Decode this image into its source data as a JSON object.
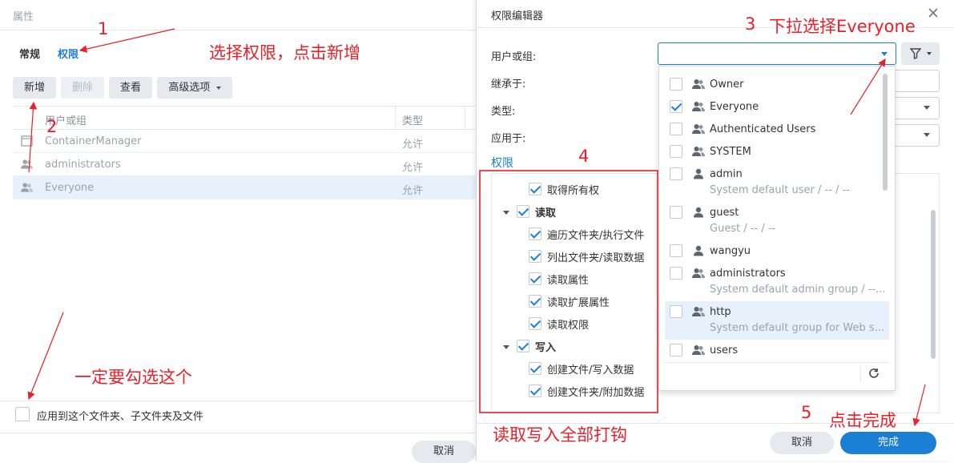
{
  "props": {
    "title": "属性",
    "tabs": [
      "常规",
      "权限"
    ],
    "buttons": {
      "add": "新增",
      "delete": "删除",
      "view": "查看",
      "advanced": "高级选项"
    },
    "columns": {
      "user": "用户或组",
      "type": "类型"
    },
    "rows": [
      {
        "name": "ContainerManager",
        "type": "允许"
      },
      {
        "name": "administrators",
        "type": "允许"
      },
      {
        "name": "Everyone",
        "type": "允许"
      }
    ],
    "apply_label": "应用到这个文件夹、子文件夹及文件",
    "cancel": "取消"
  },
  "dialog": {
    "title": "权限编辑器",
    "labels": {
      "user_group": "用户或组:",
      "inherit": "继承于:",
      "type": "类型:",
      "apply_to": "应用于:",
      "permissions": "权限"
    },
    "user_input_value": "",
    "permissions": [
      {
        "label": "取得所有权",
        "checked": true,
        "level": 1
      },
      {
        "label": "读取",
        "checked": true,
        "level": 0,
        "group": true
      },
      {
        "label": "遍历文件夹/执行文件",
        "checked": true,
        "level": 1
      },
      {
        "label": "列出文件夹/读取数据",
        "checked": true,
        "level": 1
      },
      {
        "label": "读取属性",
        "checked": true,
        "level": 1
      },
      {
        "label": "读取扩展属性",
        "checked": true,
        "level": 1
      },
      {
        "label": "读取权限",
        "checked": true,
        "level": 1
      },
      {
        "label": "写入",
        "checked": true,
        "level": 0,
        "group": true
      },
      {
        "label": "创建文件/写入数据",
        "checked": true,
        "level": 1
      },
      {
        "label": "创建文件夹/附加数据",
        "checked": true,
        "level": 1
      }
    ],
    "dropdown": [
      {
        "name": "Owner",
        "sub": "",
        "checked": false,
        "icon": "group-icon"
      },
      {
        "name": "Everyone",
        "sub": "",
        "checked": true,
        "icon": "group-icon"
      },
      {
        "name": "Authenticated Users",
        "sub": "",
        "checked": false,
        "icon": "group-icon"
      },
      {
        "name": "SYSTEM",
        "sub": "",
        "checked": false,
        "icon": "group-icon"
      },
      {
        "name": "admin",
        "sub": "System default user / -- / --",
        "checked": false,
        "icon": "user-icon"
      },
      {
        "name": "guest",
        "sub": "Guest / -- / --",
        "checked": false,
        "icon": "user-icon"
      },
      {
        "name": "wangyu",
        "sub": "",
        "checked": false,
        "icon": "user-icon"
      },
      {
        "name": "administrators",
        "sub": "System default admin group / --...",
        "checked": false,
        "icon": "group-icon"
      },
      {
        "name": "http",
        "sub": "System default group for Web s...",
        "checked": false,
        "icon": "group-icon",
        "highlighted": true
      },
      {
        "name": "users",
        "sub": "",
        "checked": false,
        "icon": "group-icon"
      }
    ],
    "cancel": "取消",
    "done": "完成"
  },
  "annotations": {
    "n1": "1",
    "n2": "2",
    "n3": "3",
    "n4": "4",
    "n5": "5",
    "a1": "选择权限，点击新增",
    "a3": "下拉选择Everyone",
    "a4": "一定要勾选这个",
    "a5": "读取写入全部打钩",
    "a6": "点击完成"
  },
  "colors": {
    "accent": "#1c7fd6",
    "annotation": "#e8202a",
    "selected_row": "#e6f1fb"
  }
}
